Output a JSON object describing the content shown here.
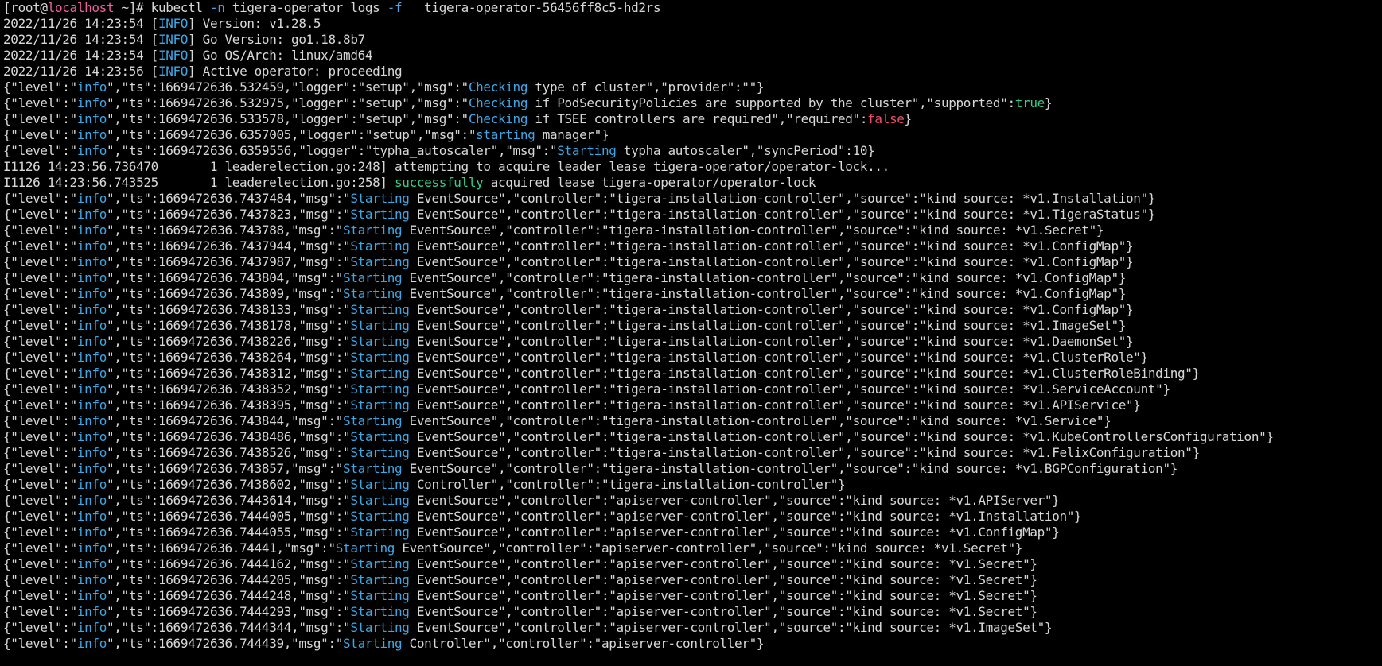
{
  "terminal": {
    "colors": {
      "background": "#000000",
      "default": "#d8d8d8",
      "host": "#f05f9e",
      "flag": "#4aa3e8",
      "info": "#3da7e6",
      "verb": "#3da7e6",
      "true": "#2fcf8d",
      "false": "#f24b6a",
      "success": "#2fcf8d"
    },
    "lines": [
      [
        [
          "[root@",
          "default"
        ],
        [
          "localhost",
          "host"
        ],
        [
          " ~]# kubectl ",
          "default"
        ],
        [
          "-n",
          "flag"
        ],
        [
          " tigera-operator logs ",
          "default"
        ],
        [
          "-f",
          "flag"
        ],
        [
          "   tigera-operator-56456ff8c5-hd2rs",
          "default"
        ]
      ],
      [
        [
          "2022/11/26 14:23:54 [",
          "default"
        ],
        [
          "INFO",
          "info"
        ],
        [
          "] Version: v1.28.5",
          "default"
        ]
      ],
      [
        [
          "2022/11/26 14:23:54 [",
          "default"
        ],
        [
          "INFO",
          "info"
        ],
        [
          "] Go Version: go1.18.8b7",
          "default"
        ]
      ],
      [
        [
          "2022/11/26 14:23:54 [",
          "default"
        ],
        [
          "INFO",
          "info"
        ],
        [
          "] Go OS/Arch: linux/amd64",
          "default"
        ]
      ],
      [
        [
          "2022/11/26 14:23:56 [",
          "default"
        ],
        [
          "INFO",
          "info"
        ],
        [
          "] Active operator: proceeding",
          "default"
        ]
      ],
      [
        [
          "{\"level\":\"",
          "default"
        ],
        [
          "info",
          "info"
        ],
        [
          "\",\"ts\":1669472636.532459,\"logger\":\"setup\",\"msg\":\"",
          "default"
        ],
        [
          "Checking",
          "verb"
        ],
        [
          " type of cluster\",\"provider\":\"\"}",
          "default"
        ]
      ],
      [
        [
          "{\"level\":\"",
          "default"
        ],
        [
          "info",
          "info"
        ],
        [
          "\",\"ts\":1669472636.532975,\"logger\":\"setup\",\"msg\":\"",
          "default"
        ],
        [
          "Checking",
          "verb"
        ],
        [
          " if PodSecurityPolicies are supported by the cluster\",\"supported\":",
          "default"
        ],
        [
          "true",
          "true"
        ],
        [
          "}",
          "default"
        ]
      ],
      [
        [
          "{\"level\":\"",
          "default"
        ],
        [
          "info",
          "info"
        ],
        [
          "\",\"ts\":1669472636.533578,\"logger\":\"setup\",\"msg\":\"",
          "default"
        ],
        [
          "Checking",
          "verb"
        ],
        [
          " if TSEE controllers are required\",\"required\":",
          "default"
        ],
        [
          "false",
          "false"
        ],
        [
          "}",
          "default"
        ]
      ],
      [
        [
          "{\"level\":\"",
          "default"
        ],
        [
          "info",
          "info"
        ],
        [
          "\",\"ts\":1669472636.6357005,\"logger\":\"setup\",\"msg\":\"",
          "default"
        ],
        [
          "starting",
          "verb"
        ],
        [
          " manager\"}",
          "default"
        ]
      ],
      [
        [
          "{\"level\":\"",
          "default"
        ],
        [
          "info",
          "info"
        ],
        [
          "\",\"ts\":1669472636.6359556,\"logger\":\"typha_autoscaler\",\"msg\":\"",
          "default"
        ],
        [
          "Starting",
          "verb"
        ],
        [
          " typha autoscaler\",\"syncPeriod\":10}",
          "default"
        ]
      ],
      [
        [
          "I1126 14:23:56.736470       1 leaderelection.go:248] attempting to acquire leader lease tigera-operator/operator-lock...",
          "default"
        ]
      ],
      [
        [
          "I1126 14:23:56.743525       1 leaderelection.go:258] ",
          "default"
        ],
        [
          "successfully",
          "success"
        ],
        [
          " acquired lease tigera-operator/operator-lock",
          "default"
        ]
      ],
      [
        [
          "{\"level\":\"",
          "default"
        ],
        [
          "info",
          "info"
        ],
        [
          "\",\"ts\":1669472636.7437484,\"msg\":\"",
          "default"
        ],
        [
          "Starting",
          "verb"
        ],
        [
          " EventSource\",\"controller\":\"tigera-installation-controller\",\"source\":\"kind source: *v1.Installation\"}",
          "default"
        ]
      ],
      [
        [
          "{\"level\":\"",
          "default"
        ],
        [
          "info",
          "info"
        ],
        [
          "\",\"ts\":1669472636.7437823,\"msg\":\"",
          "default"
        ],
        [
          "Starting",
          "verb"
        ],
        [
          " EventSource\",\"controller\":\"tigera-installation-controller\",\"source\":\"kind source: *v1.TigeraStatus\"}",
          "default"
        ]
      ],
      [
        [
          "{\"level\":\"",
          "default"
        ],
        [
          "info",
          "info"
        ],
        [
          "\",\"ts\":1669472636.743788,\"msg\":\"",
          "default"
        ],
        [
          "Starting",
          "verb"
        ],
        [
          " EventSource\",\"controller\":\"tigera-installation-controller\",\"source\":\"kind source: *v1.Secret\"}",
          "default"
        ]
      ],
      [
        [
          "{\"level\":\"",
          "default"
        ],
        [
          "info",
          "info"
        ],
        [
          "\",\"ts\":1669472636.7437944,\"msg\":\"",
          "default"
        ],
        [
          "Starting",
          "verb"
        ],
        [
          " EventSource\",\"controller\":\"tigera-installation-controller\",\"source\":\"kind source: *v1.ConfigMap\"}",
          "default"
        ]
      ],
      [
        [
          "{\"level\":\"",
          "default"
        ],
        [
          "info",
          "info"
        ],
        [
          "\",\"ts\":1669472636.7437987,\"msg\":\"",
          "default"
        ],
        [
          "Starting",
          "verb"
        ],
        [
          " EventSource\",\"controller\":\"tigera-installation-controller\",\"source\":\"kind source: *v1.ConfigMap\"}",
          "default"
        ]
      ],
      [
        [
          "{\"level\":\"",
          "default"
        ],
        [
          "info",
          "info"
        ],
        [
          "\",\"ts\":1669472636.743804,\"msg\":\"",
          "default"
        ],
        [
          "Starting",
          "verb"
        ],
        [
          " EventSource\",\"controller\":\"tigera-installation-controller\",\"source\":\"kind source: *v1.ConfigMap\"}",
          "default"
        ]
      ],
      [
        [
          "{\"level\":\"",
          "default"
        ],
        [
          "info",
          "info"
        ],
        [
          "\",\"ts\":1669472636.743809,\"msg\":\"",
          "default"
        ],
        [
          "Starting",
          "verb"
        ],
        [
          " EventSource\",\"controller\":\"tigera-installation-controller\",\"source\":\"kind source: *v1.ConfigMap\"}",
          "default"
        ]
      ],
      [
        [
          "{\"level\":\"",
          "default"
        ],
        [
          "info",
          "info"
        ],
        [
          "\",\"ts\":1669472636.7438133,\"msg\":\"",
          "default"
        ],
        [
          "Starting",
          "verb"
        ],
        [
          " EventSource\",\"controller\":\"tigera-installation-controller\",\"source\":\"kind source: *v1.ConfigMap\"}",
          "default"
        ]
      ],
      [
        [
          "{\"level\":\"",
          "default"
        ],
        [
          "info",
          "info"
        ],
        [
          "\",\"ts\":1669472636.7438178,\"msg\":\"",
          "default"
        ],
        [
          "Starting",
          "verb"
        ],
        [
          " EventSource\",\"controller\":\"tigera-installation-controller\",\"source\":\"kind source: *v1.ImageSet\"}",
          "default"
        ]
      ],
      [
        [
          "{\"level\":\"",
          "default"
        ],
        [
          "info",
          "info"
        ],
        [
          "\",\"ts\":1669472636.7438226,\"msg\":\"",
          "default"
        ],
        [
          "Starting",
          "verb"
        ],
        [
          " EventSource\",\"controller\":\"tigera-installation-controller\",\"source\":\"kind source: *v1.DaemonSet\"}",
          "default"
        ]
      ],
      [
        [
          "{\"level\":\"",
          "default"
        ],
        [
          "info",
          "info"
        ],
        [
          "\",\"ts\":1669472636.7438264,\"msg\":\"",
          "default"
        ],
        [
          "Starting",
          "verb"
        ],
        [
          " EventSource\",\"controller\":\"tigera-installation-controller\",\"source\":\"kind source: *v1.ClusterRole\"}",
          "default"
        ]
      ],
      [
        [
          "{\"level\":\"",
          "default"
        ],
        [
          "info",
          "info"
        ],
        [
          "\",\"ts\":1669472636.7438312,\"msg\":\"",
          "default"
        ],
        [
          "Starting",
          "verb"
        ],
        [
          " EventSource\",\"controller\":\"tigera-installation-controller\",\"source\":\"kind source: *v1.ClusterRoleBinding\"}",
          "default"
        ]
      ],
      [
        [
          "{\"level\":\"",
          "default"
        ],
        [
          "info",
          "info"
        ],
        [
          "\",\"ts\":1669472636.7438352,\"msg\":\"",
          "default"
        ],
        [
          "Starting",
          "verb"
        ],
        [
          " EventSource\",\"controller\":\"tigera-installation-controller\",\"source\":\"kind source: *v1.ServiceAccount\"}",
          "default"
        ]
      ],
      [
        [
          "{\"level\":\"",
          "default"
        ],
        [
          "info",
          "info"
        ],
        [
          "\",\"ts\":1669472636.7438395,\"msg\":\"",
          "default"
        ],
        [
          "Starting",
          "verb"
        ],
        [
          " EventSource\",\"controller\":\"tigera-installation-controller\",\"source\":\"kind source: *v1.APIService\"}",
          "default"
        ]
      ],
      [
        [
          "{\"level\":\"",
          "default"
        ],
        [
          "info",
          "info"
        ],
        [
          "\",\"ts\":1669472636.743844,\"msg\":\"",
          "default"
        ],
        [
          "Starting",
          "verb"
        ],
        [
          " EventSource\",\"controller\":\"tigera-installation-controller\",\"source\":\"kind source: *v1.Service\"}",
          "default"
        ]
      ],
      [
        [
          "{\"level\":\"",
          "default"
        ],
        [
          "info",
          "info"
        ],
        [
          "\",\"ts\":1669472636.7438486,\"msg\":\"",
          "default"
        ],
        [
          "Starting",
          "verb"
        ],
        [
          " EventSource\",\"controller\":\"tigera-installation-controller\",\"source\":\"kind source: *v1.KubeControllersConfiguration\"}",
          "default"
        ]
      ],
      [
        [
          "{\"level\":\"",
          "default"
        ],
        [
          "info",
          "info"
        ],
        [
          "\",\"ts\":1669472636.7438526,\"msg\":\"",
          "default"
        ],
        [
          "Starting",
          "verb"
        ],
        [
          " EventSource\",\"controller\":\"tigera-installation-controller\",\"source\":\"kind source: *v1.FelixConfiguration\"}",
          "default"
        ]
      ],
      [
        [
          "{\"level\":\"",
          "default"
        ],
        [
          "info",
          "info"
        ],
        [
          "\",\"ts\":1669472636.743857,\"msg\":\"",
          "default"
        ],
        [
          "Starting",
          "verb"
        ],
        [
          " EventSource\",\"controller\":\"tigera-installation-controller\",\"source\":\"kind source: *v1.BGPConfiguration\"}",
          "default"
        ]
      ],
      [
        [
          "{\"level\":\"",
          "default"
        ],
        [
          "info",
          "info"
        ],
        [
          "\",\"ts\":1669472636.7438602,\"msg\":\"",
          "default"
        ],
        [
          "Starting",
          "verb"
        ],
        [
          " Controller\",\"controller\":\"tigera-installation-controller\"}",
          "default"
        ]
      ],
      [
        [
          "{\"level\":\"",
          "default"
        ],
        [
          "info",
          "info"
        ],
        [
          "\",\"ts\":1669472636.7443614,\"msg\":\"",
          "default"
        ],
        [
          "Starting",
          "verb"
        ],
        [
          " EventSource\",\"controller\":\"apiserver-controller\",\"source\":\"kind source: *v1.APIServer\"}",
          "default"
        ]
      ],
      [
        [
          "{\"level\":\"",
          "default"
        ],
        [
          "info",
          "info"
        ],
        [
          "\",\"ts\":1669472636.7444005,\"msg\":\"",
          "default"
        ],
        [
          "Starting",
          "verb"
        ],
        [
          " EventSource\",\"controller\":\"apiserver-controller\",\"source\":\"kind source: *v1.Installation\"}",
          "default"
        ]
      ],
      [
        [
          "{\"level\":\"",
          "default"
        ],
        [
          "info",
          "info"
        ],
        [
          "\",\"ts\":1669472636.7444055,\"msg\":\"",
          "default"
        ],
        [
          "Starting",
          "verb"
        ],
        [
          " EventSource\",\"controller\":\"apiserver-controller\",\"source\":\"kind source: *v1.ConfigMap\"}",
          "default"
        ]
      ],
      [
        [
          "{\"level\":\"",
          "default"
        ],
        [
          "info",
          "info"
        ],
        [
          "\",\"ts\":1669472636.74441,\"msg\":\"",
          "default"
        ],
        [
          "Starting",
          "verb"
        ],
        [
          " EventSource\",\"controller\":\"apiserver-controller\",\"source\":\"kind source: *v1.Secret\"}",
          "default"
        ]
      ],
      [
        [
          "{\"level\":\"",
          "default"
        ],
        [
          "info",
          "info"
        ],
        [
          "\",\"ts\":1669472636.7444162,\"msg\":\"",
          "default"
        ],
        [
          "Starting",
          "verb"
        ],
        [
          " EventSource\",\"controller\":\"apiserver-controller\",\"source\":\"kind source: *v1.Secret\"}",
          "default"
        ]
      ],
      [
        [
          "{\"level\":\"",
          "default"
        ],
        [
          "info",
          "info"
        ],
        [
          "\",\"ts\":1669472636.7444205,\"msg\":\"",
          "default"
        ],
        [
          "Starting",
          "verb"
        ],
        [
          " EventSource\",\"controller\":\"apiserver-controller\",\"source\":\"kind source: *v1.Secret\"}",
          "default"
        ]
      ],
      [
        [
          "{\"level\":\"",
          "default"
        ],
        [
          "info",
          "info"
        ],
        [
          "\",\"ts\":1669472636.7444248,\"msg\":\"",
          "default"
        ],
        [
          "Starting",
          "verb"
        ],
        [
          " EventSource\",\"controller\":\"apiserver-controller\",\"source\":\"kind source: *v1.Secret\"}",
          "default"
        ]
      ],
      [
        [
          "{\"level\":\"",
          "default"
        ],
        [
          "info",
          "info"
        ],
        [
          "\",\"ts\":1669472636.7444293,\"msg\":\"",
          "default"
        ],
        [
          "Starting",
          "verb"
        ],
        [
          " EventSource\",\"controller\":\"apiserver-controller\",\"source\":\"kind source: *v1.Secret\"}",
          "default"
        ]
      ],
      [
        [
          "{\"level\":\"",
          "default"
        ],
        [
          "info",
          "info"
        ],
        [
          "\",\"ts\":1669472636.7444344,\"msg\":\"",
          "default"
        ],
        [
          "Starting",
          "verb"
        ],
        [
          " EventSource\",\"controller\":\"apiserver-controller\",\"source\":\"kind source: *v1.ImageSet\"}",
          "default"
        ]
      ],
      [
        [
          "{\"level\":\"",
          "default"
        ],
        [
          "info",
          "info"
        ],
        [
          "\",\"ts\":1669472636.744439,\"msg\":\"",
          "default"
        ],
        [
          "Starting",
          "verb"
        ],
        [
          " Controller\",\"controller\":\"apiserver-controller\"}",
          "default"
        ]
      ]
    ]
  }
}
